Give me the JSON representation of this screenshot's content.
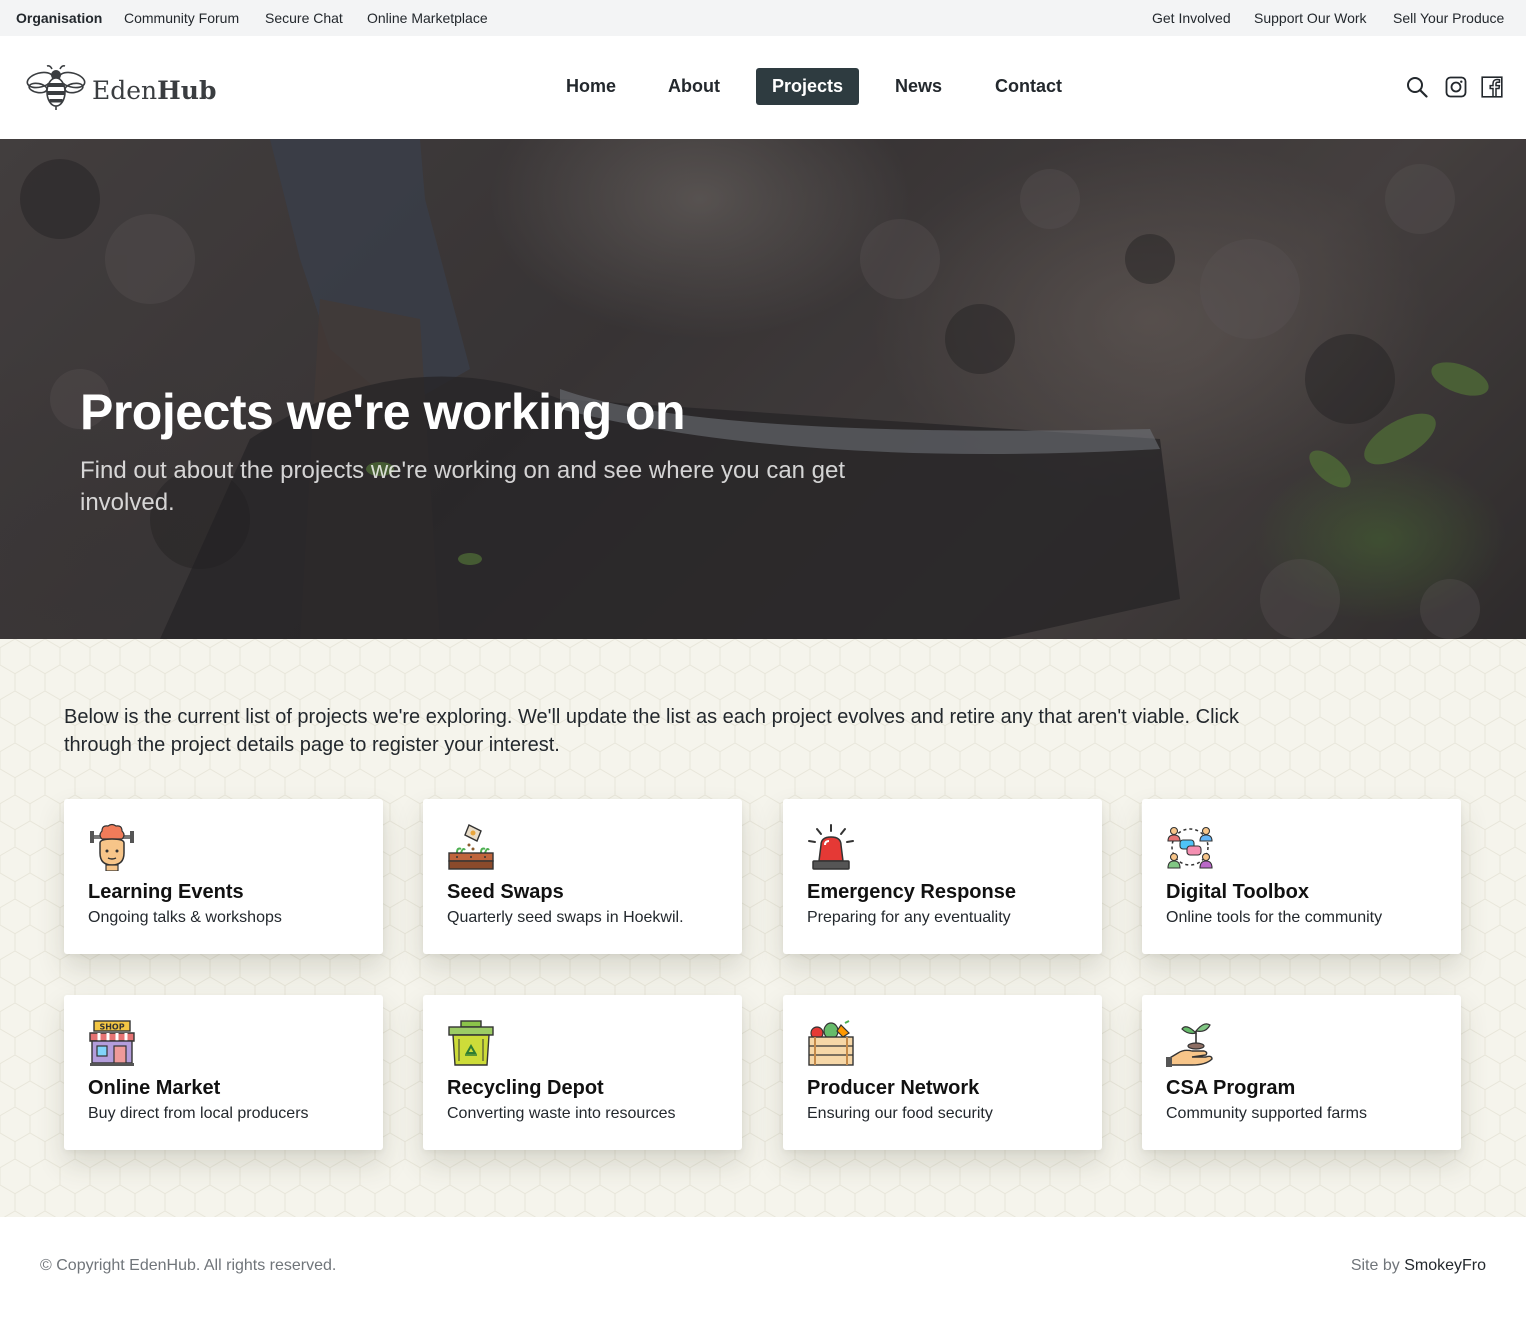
{
  "topbar": {
    "left": [
      "Organisation",
      "Community Forum",
      "Secure Chat",
      "Online Marketplace"
    ],
    "right": [
      "Get Involved",
      "Support Our Work",
      "Sell Your Produce"
    ]
  },
  "brand": {
    "name_light": "Eden",
    "name_bold": "Hub"
  },
  "nav": {
    "items": [
      "Home",
      "About",
      "Projects",
      "News",
      "Contact"
    ],
    "active": "Projects"
  },
  "header_icons": [
    "search-icon",
    "instagram-icon",
    "facebook-icon"
  ],
  "hero": {
    "title": "Projects we're working on",
    "subtitle": "Find out about the projects we're working on and see where you can get involved."
  },
  "intro": "Below is the current list of projects we're exploring. We'll update the list as each project evolves and retire any that aren't viable. Click through the project details page to register your interest.",
  "projects": [
    {
      "title": "Learning Events",
      "subtitle": "Ongoing talks & workshops",
      "icon": "brain-workout-icon"
    },
    {
      "title": "Seed Swaps",
      "subtitle": "Quarterly seed swaps in Hoekwil.",
      "icon": "seed-planting-icon"
    },
    {
      "title": "Emergency Response",
      "subtitle": "Preparing for any eventuality",
      "icon": "siren-icon"
    },
    {
      "title": "Digital Toolbox",
      "subtitle": "Online tools for the community",
      "icon": "network-chat-icon"
    },
    {
      "title": "Online Market",
      "subtitle": "Buy direct from local producers",
      "icon": "shop-icon",
      "icon_text": "SHOP"
    },
    {
      "title": "Recycling Depot",
      "subtitle": "Converting waste into resources",
      "icon": "recycling-bin-icon"
    },
    {
      "title": "Producer Network",
      "subtitle": "Ensuring our food security",
      "icon": "produce-crate-icon"
    },
    {
      "title": "CSA Program",
      "subtitle": "Community supported farms",
      "icon": "hand-seedling-icon"
    }
  ],
  "footer": {
    "copyright": "© Copyright EdenHub. All rights reserved.",
    "credit_prefix": "Site by",
    "credit_name": "SmokeyFro"
  },
  "colors": {
    "nav_active_bg": "#2e3b40",
    "topbar_bg": "#f3f4f5",
    "content_bg": "#f5f4ec"
  }
}
